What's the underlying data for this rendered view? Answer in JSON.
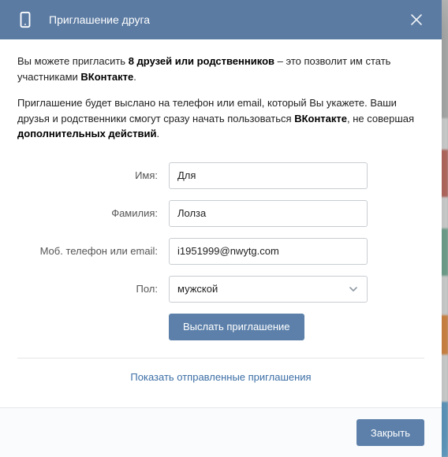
{
  "header": {
    "title": "Приглашение друга"
  },
  "intro": {
    "line1_pre": "Вы можете пригласить ",
    "line1_bold": "8 друзей или родственников",
    "line1_post": " – это позволит им стать участниками ",
    "line1_bold2": "ВКонтакте",
    "line1_end": ".",
    "line2_pre": "Приглашение будет выслано на телефон или email, который Вы укажете. Ваши друзья и родственники смогут сразу начать пользоваться ",
    "line2_bold": "ВКонтакте",
    "line2_post": ", не совершая ",
    "line2_bold2": "дополнительных действий",
    "line2_end": "."
  },
  "form": {
    "first_name_label": "Имя:",
    "first_name_value": "Для",
    "last_name_label": "Фамилия:",
    "last_name_value": "Лолза",
    "contact_label": "Моб. телефон или email:",
    "contact_value": "i1951999@nwytg.com",
    "gender_label": "Пол:",
    "gender_value": "мужской",
    "submit_label": "Выслать приглашение"
  },
  "link": {
    "show_sent": "Показать отправленные приглашения"
  },
  "footer": {
    "close_label": "Закрыть"
  }
}
